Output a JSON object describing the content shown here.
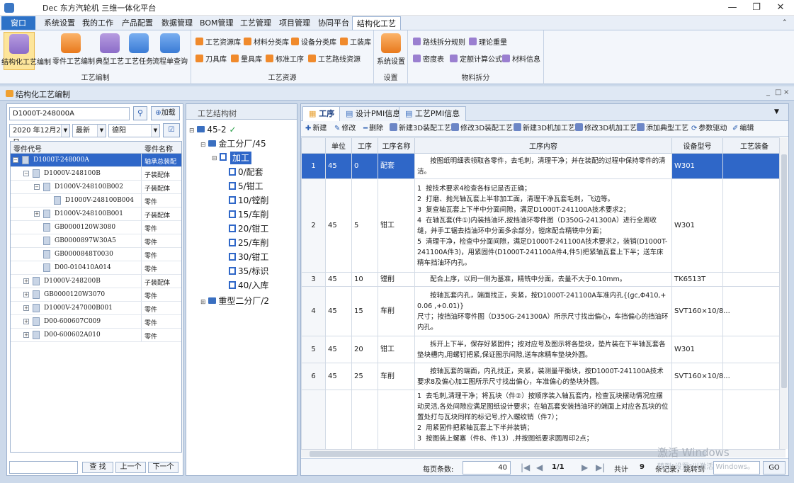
{
  "window": {
    "title": "Dec 东方汽轮机 三维一体化平台",
    "min": "—",
    "max": "❐",
    "close": "✕"
  },
  "menu": {
    "first": "窗口",
    "items": [
      "系统设置",
      "我的工作",
      "产品配置",
      "数据管理",
      "BOM管理",
      "工艺管理",
      "项目管理",
      "协同平台"
    ],
    "active": "结构化工艺"
  },
  "ribbon": {
    "groups": {
      "edit": {
        "label": "工艺编制",
        "buttons": [
          "结构化工艺编制",
          "零件工艺编制",
          "典型工艺",
          "工艺任务",
          "流程单查询"
        ]
      },
      "resources": {
        "label": "工艺资源",
        "row1": [
          "工艺资源库",
          "材料分类库",
          "设备分类库",
          "工装库"
        ],
        "row2": [
          "刀具库",
          "量具库",
          "标准工序",
          "工艺路线资源"
        ]
      },
      "settings": {
        "label": "设置",
        "button": "系统设置"
      },
      "material": {
        "label": "物料拆分",
        "row1": [
          "路线拆分规则",
          "理论重量"
        ],
        "row2": [
          "密度表",
          "定额计算公式",
          "材料信息"
        ]
      }
    }
  },
  "mdi": {
    "title": "结构化工艺编制",
    "ctl_min": "_",
    "ctl_max": "□",
    "ctl_close": "×"
  },
  "left": {
    "search_value": "D1000T-248000A",
    "load_label": "加载",
    "date": "2020 年12月21 日",
    "version": "最新",
    "factory": "德阳",
    "columns": [
      "零件代号",
      "零件名称"
    ],
    "rows": [
      {
        "code": "D1000T-248000A",
        "name": "轴承总装配件"
      },
      {
        "code": "D1000V-248100B",
        "name": "子装配体"
      },
      {
        "code": "D1000V-248100B002",
        "name": "子装配体"
      },
      {
        "code": "D1000V-248100B004",
        "name": "零件"
      },
      {
        "code": "D1000V-248100B001",
        "name": "子装配体"
      },
      {
        "code": "GB0000120W3080",
        "name": "零件"
      },
      {
        "code": "GB0000897W30A5",
        "name": "零件"
      },
      {
        "code": "GB0000848T0030",
        "name": "零件"
      },
      {
        "code": "D00-010410A014",
        "name": "零件"
      },
      {
        "code": "D1000V-248200B",
        "name": "子装配体"
      },
      {
        "code": "GB0000120W3070",
        "name": "零件"
      },
      {
        "code": "D1000V-247000B001",
        "name": "零件"
      },
      {
        "code": "D00-600607C009",
        "name": "零件"
      },
      {
        "code": "D00-600602A010",
        "name": "零件"
      }
    ],
    "find_label": "查 找",
    "prev_label": "上一个",
    "next_label": "下一个"
  },
  "tree": {
    "header": "工艺结构树",
    "root": "45-2",
    "plant1": "金工分厂/45",
    "process": "加工",
    "ops": [
      "0/配套",
      "5/钳工",
      "10/镗削",
      "15/车削",
      "20/钳工",
      "25/车削",
      "30/钳工",
      "35/标识",
      "40/入库"
    ],
    "plant2": "重型二分厂/2"
  },
  "right": {
    "tabs": [
      "工序",
      "设计PMI信息",
      "工艺PMI信息"
    ],
    "toolbar": [
      "新建",
      "修改",
      "删除",
      "新建3D装配工艺",
      "修改3D装配工艺",
      "新建3D机加工艺",
      "修改3D机加工艺",
      "添加典型工艺",
      "参数驱动",
      "编辑"
    ],
    "columns": [
      "",
      "单位",
      "工序",
      "工序名称",
      "工序内容",
      "设备型号",
      "工艺装备"
    ],
    "rows": [
      {
        "no": "1",
        "unit": "45",
        "op": "0",
        "name": "配套",
        "content": "      按图纸明细表领取各零件，去毛刺，清理干净；并在装配的过程中保持零件的清洁。",
        "equip": "W301"
      },
      {
        "no": "2",
        "unit": "45",
        "op": "5",
        "name": "钳工",
        "content": "1  按技术要求4检查各标记是否正确；\n2  打磨、抛光轴瓦套上半非加工面，清理干净瓦套毛刺，飞边等。\n3  复查轴瓦套上下半中分面间隙，满足D1000T-241100A技术要求2；\n4  在轴瓦套(件①)内装挡油环,按挡油环零件图（D350G-241300A）进行全周收缝，并手工锯去挡油环中分面多余部分，镗床配合精铣中分面；\n5  清理干净，检查中分面间隙，满足D1000T-241100A技术要求2，装销(D1000T-241100A件3)，用紧固件(D1000T-241100A件4,件5)把紧轴瓦套上下半；送车床精车挡油环内孔。",
        "equip": "W301"
      },
      {
        "no": "3",
        "unit": "45",
        "op": "10",
        "name": "镗削",
        "content": "      配合上序，以同一侧为基准，精铣中分面，去量不大于0.10mm。",
        "equip": "TK6513T"
      },
      {
        "no": "4",
        "unit": "45",
        "op": "15",
        "name": "车削",
        "content": "      按轴瓦套内孔，端面找正，夹紧，按D1000T-241100A车准内孔{(gc,Φ410,+0.06 ,+0.01)}\n尺寸；按挡油环零件图（D350G-241300A）所示尺寸找出偏心，车挡偏心的挡油环内孔。",
        "equip": "SVT160×10/8..."
      },
      {
        "no": "5",
        "unit": "45",
        "op": "20",
        "name": "钳工",
        "content": "      拆开上下半，保存好紧固件；按对应号及图示将各垫块，垫片装在下半轴瓦套各垫块槽内,用螺钉把紧,保证图示间隙,送车床精车垫块外圆。",
        "equip": "W301"
      },
      {
        "no": "6",
        "unit": "45",
        "op": "25",
        "name": "车削",
        "content": "      按轴瓦套的端面，内孔找正，夹紧，装测量平衡块，按D1000T-241100A技术要求8及偏心加工图所示尺寸找出偏心，车准偏心的垫块外圆。",
        "equip": "SVT160×10/8..."
      },
      {
        "no": "",
        "unit": "",
        "op": "",
        "name": "",
        "content": "1  去毛刺,清理干净；将瓦块（件②）按顺序装入轴瓦套内，检查瓦块摆动情况应摆动灵活,各处间隙应满足图纸设计要求；在轴瓦套安装挡油环的端面上对应各瓦块的位置处打与瓦块同样的标记号,拧入螺纹销（件7）；\n2  用紧固件把紧轴瓦套上下半并装销；\n3  按图装上螺塞（件8、件13）,并按图纸要求圆周印2点；",
        "equip": ""
      }
    ],
    "pager": {
      "page_size_label": "每页条数:",
      "page_size": "40",
      "page": "1/1",
      "total_label": "共计",
      "total": "9",
      "records_label": "条记录，跳转到",
      "go_label": "GO"
    }
  },
  "watermark": {
    "line1": "激活 Windows",
    "line2": "转到\"设置\"以激活 Windows。"
  }
}
